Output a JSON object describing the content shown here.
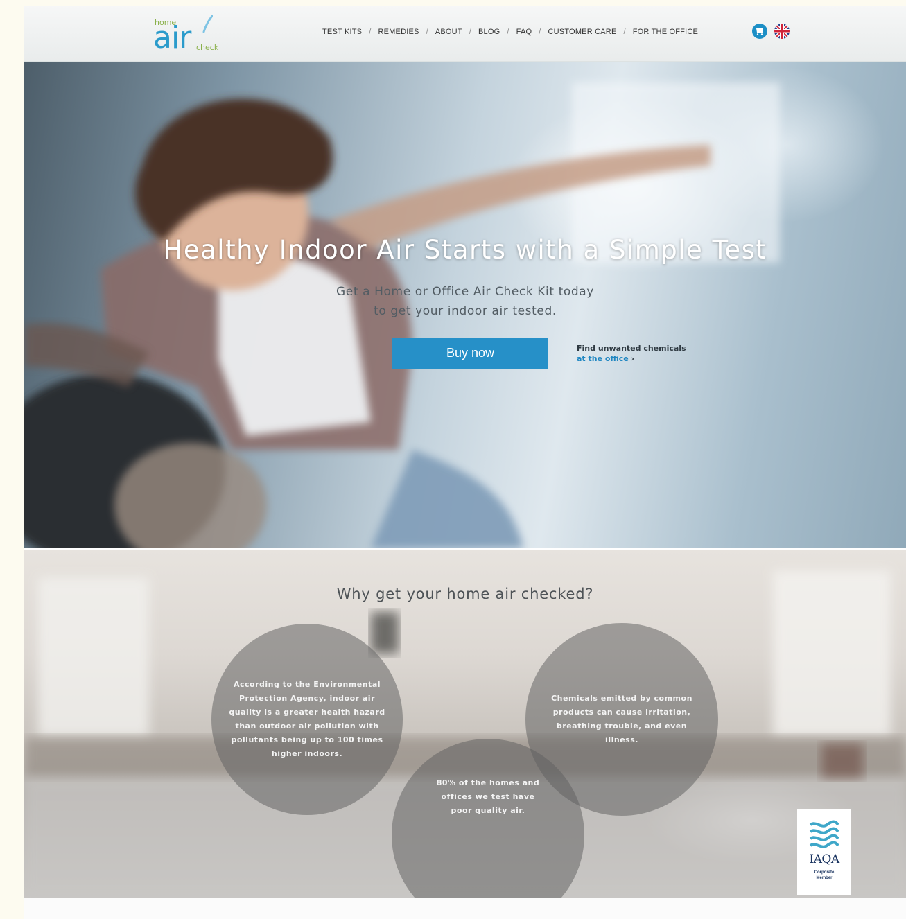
{
  "logo": {
    "word_home": "home",
    "word_air": "air",
    "word_check": "check"
  },
  "nav": {
    "items": [
      "TEST KITS",
      "REMEDIES",
      "ABOUT",
      "BLOG",
      "FAQ",
      "CUSTOMER CARE",
      "FOR THE OFFICE"
    ],
    "separator": "/"
  },
  "icons": {
    "cart": "shopping-cart-icon",
    "language": "uk-flag-icon"
  },
  "hero": {
    "title": "Healthy Indoor Air Starts with a Simple Test",
    "subtitle_line1": "Get a Home or Office Air Check Kit today",
    "subtitle_line2": "to get your indoor air tested.",
    "buy_label": "Buy now",
    "find_line1": "Find unwanted chemicals",
    "find_link": "at the office",
    "find_arrow": "›"
  },
  "why": {
    "title": "Why get your home air checked?",
    "circles": [
      "According to the Environmental Protection Agency, indoor air quality is a greater health hazard than outdoor air pollution with pollutants being up to 100 times higher indoors.",
      "Chemicals emitted by common products can cause irritation, breathing trouble, and even illness.",
      "80% of the homes and offices we test have poor quality air."
    ]
  },
  "badge": {
    "name": "IAQA",
    "line1": "Corporate",
    "line2": "Member"
  },
  "colors": {
    "accent": "#2690c8",
    "logo_blue": "#2a9bcb",
    "logo_green": "#8ab14a",
    "badge_navy": "#1a3460"
  }
}
